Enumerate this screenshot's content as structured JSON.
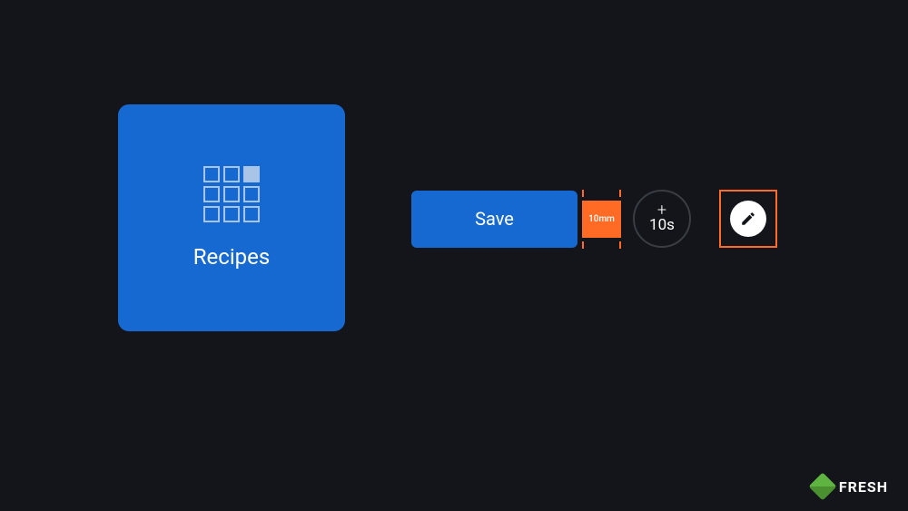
{
  "card": {
    "label": "Recipes"
  },
  "controls": {
    "save_label": "Save",
    "spacing_value": "10mm",
    "timer_plus": "+",
    "timer_value": "10s"
  },
  "logo": {
    "text": "FRESH"
  }
}
